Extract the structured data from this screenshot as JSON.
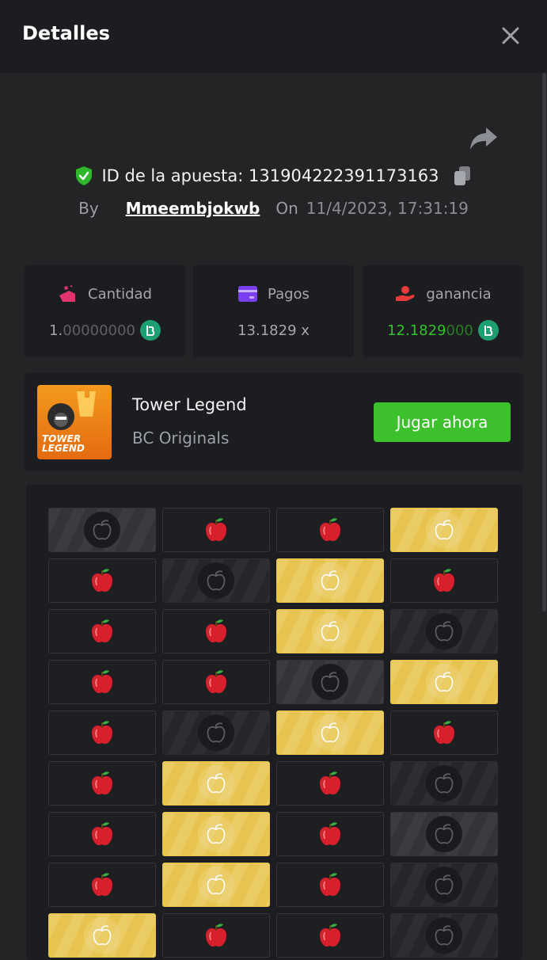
{
  "header": {
    "title": "Detalles"
  },
  "bet": {
    "id_label": "ID de la apuesta: 131904222391173163",
    "by_label": "By",
    "user": "Mmeembjokwb",
    "on_label": "On",
    "date": "11/4/2023, 17:31:19"
  },
  "stats": {
    "cantidad": {
      "label": "Cantidad",
      "value_main": "1.",
      "value_dim": "00000000"
    },
    "pagos": {
      "label": "Pagos",
      "value": "13.1829 x"
    },
    "ganancia": {
      "label": "ganancia",
      "value_main": "12.1829",
      "value_dim": "000"
    }
  },
  "game": {
    "thumb_text": "TOWER LEGEND",
    "name": "Tower Legend",
    "provider": "BC Originals",
    "play_label": "Jugar ahora"
  },
  "board": {
    "rows": [
      [
        "grey",
        "apple",
        "apple",
        "gold"
      ],
      [
        "apple",
        "dark",
        "gold",
        "apple"
      ],
      [
        "apple",
        "apple",
        "gold",
        "dark"
      ],
      [
        "apple",
        "apple",
        "grey",
        "gold"
      ],
      [
        "apple",
        "dark",
        "gold",
        "apple"
      ],
      [
        "apple",
        "gold",
        "apple",
        "dark"
      ],
      [
        "apple",
        "gold",
        "apple",
        "grey"
      ],
      [
        "apple",
        "gold",
        "apple",
        "dark"
      ],
      [
        "gold",
        "apple",
        "apple",
        "dark"
      ]
    ]
  },
  "colors": {
    "accent_green": "#3cc02c",
    "gold_cell": "#e7c44f",
    "coin": "#1d9f71",
    "shield": "#2fb72b"
  },
  "icons": {
    "close": "close-icon",
    "share": "share-icon",
    "verified": "shield-check-icon",
    "copy": "copy-icon",
    "amount": "amount-icon",
    "payout": "card-icon",
    "profit": "hand-coin-icon",
    "currency": "bc-coin-icon",
    "apple": "apple-icon"
  }
}
